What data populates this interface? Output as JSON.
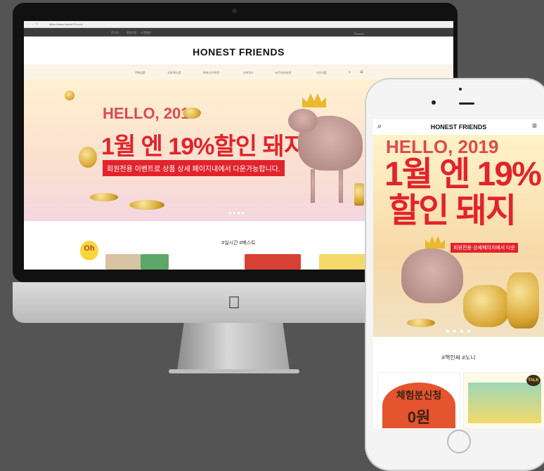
{
  "desktop": {
    "address_bar": "https://www.honest79.co.kr",
    "util_links": [
      "로그인",
      "회원가입",
      "고객센터"
    ],
    "logo": "HONEST FRIENDS",
    "nav": [
      "전체상품",
      "고정/특소품",
      "최저/다이어트",
      "슈퍼푸드",
      "뉴트리션/분말",
      "신선식품"
    ],
    "hero_line1": "HELLO, 2019",
    "hero_line2": "1월 엔 19%할인 돼지",
    "hero_sub": "회원전용 이벤트로 상품 상세 페이지내에서 다운가능합니다.",
    "section_title": "#실시간 #베스트",
    "badge_text": "Oh"
  },
  "mobile": {
    "logo": "HONEST FRIENDS",
    "hero_line1": "HELLO, 2019",
    "hero_line2": "1월 엔 19%",
    "hero_line3": "할인 돼지",
    "hero_sub": "회원전용·상세페이지에서 다운",
    "section_title": "#핵인싸 #노니",
    "card1_text": "체험분신청",
    "card1_price": "0원",
    "talk_badge": "TALK"
  },
  "colors": {
    "accent_red": "#e2232c",
    "background": "#545454"
  }
}
